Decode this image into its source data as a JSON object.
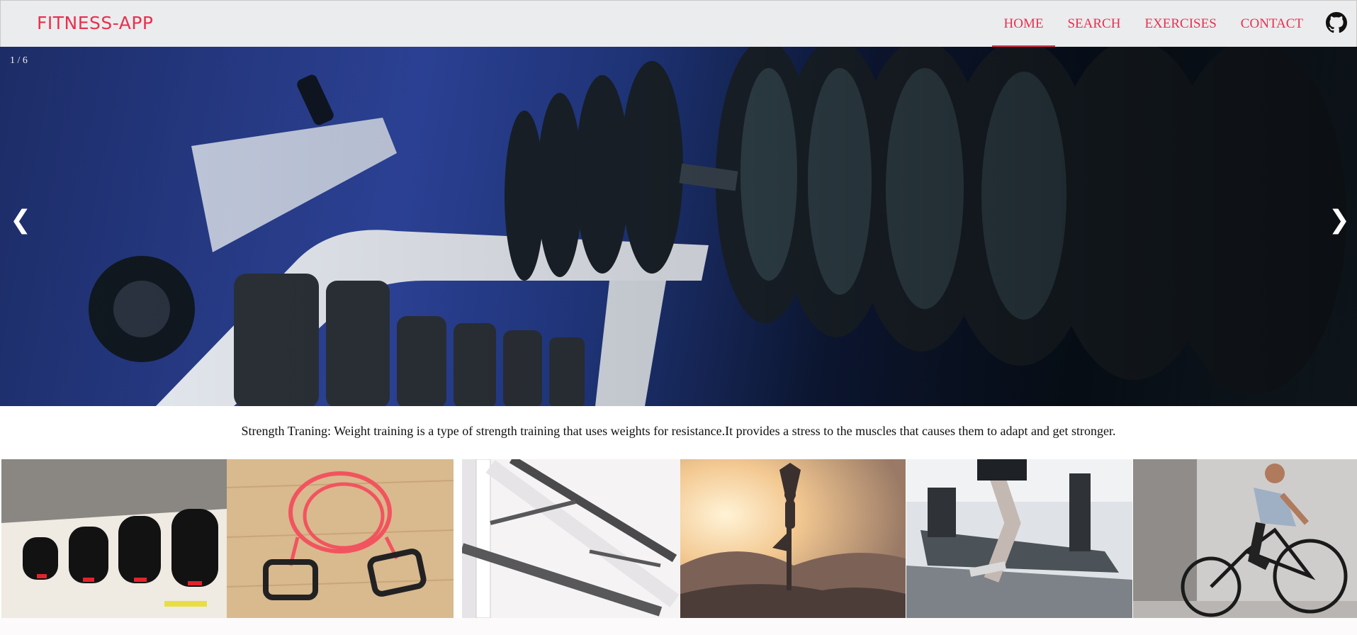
{
  "navbar": {
    "brand": "FITNESS-APP",
    "links": [
      "HOME",
      "SEARCH",
      "EXERCISES",
      "CONTACT"
    ],
    "active": "HOME",
    "github_icon": "github-icon"
  },
  "slideshow": {
    "counter": "1 / 6",
    "prev": "❮",
    "next": "❯",
    "caption": "Strength Traning: Weight training is a type of strength training that uses weights for resistance.It provides a stress to the muscles that causes them to adapt and get stronger."
  },
  "thumbnails": [
    "dumbbells",
    "resistance-band",
    "pull-up-bar",
    "yoga",
    "treadmill",
    "cycling"
  ],
  "colors": {
    "accent": "#e8304f",
    "navbar_bg": "#ebecee"
  }
}
